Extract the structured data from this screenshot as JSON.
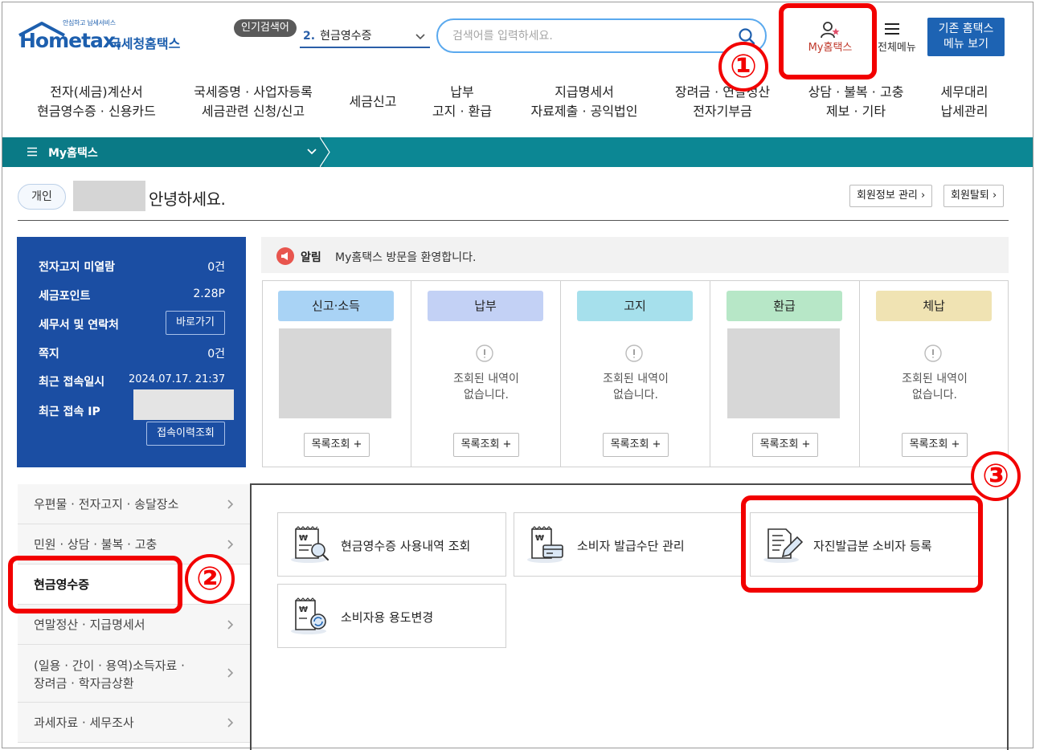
{
  "header": {
    "logo_small": "안심하고 납세서비스",
    "logo_text": "Hometax.",
    "logo_name": "국세청홈택스",
    "popular_badge": "인기검색어",
    "popular_rank": "2.",
    "popular_value": "현금영수증",
    "search_placeholder": "검색어를 입력하세요.",
    "my_hometax": "My홈택스",
    "all_menu": "전체메뉴",
    "old_menu_line1": "기존 홈택스",
    "old_menu_line2": "메뉴 보기"
  },
  "gnb": [
    {
      "line1": "전자(세금)계산서",
      "line2": "현금영수증 · 신용카드"
    },
    {
      "line1": "국세증명 · 사업자등록",
      "line2": "세금관련 신청/신고"
    },
    {
      "line1": "세금신고",
      "line2": ""
    },
    {
      "line1": "납부",
      "line2": "고지 · 환급"
    },
    {
      "line1": "지급명세서",
      "line2": "자료제출 · 공익법인"
    },
    {
      "line1": "장려금 · 연말정산",
      "line2": "전자기부금"
    },
    {
      "line1": "상담 · 불복 · 고충",
      "line2": "제보 · 기타"
    },
    {
      "line1": "세무대리",
      "line2": "납세관리"
    }
  ],
  "breadcrumb": {
    "label": "My홈택스"
  },
  "greeting": {
    "user_type": "개인",
    "text": "안녕하세요.",
    "member_info": "회원정보 관리",
    "withdraw": "회원탈퇴"
  },
  "info": {
    "rows": [
      {
        "label": "전자고지 미열람",
        "value": "0건"
      },
      {
        "label": "세금포인트",
        "value": "2.28P"
      },
      {
        "label": "세무서 및 연락처",
        "button": "바로가기"
      },
      {
        "label": "쪽지",
        "value": "0건"
      },
      {
        "label": "최근 접속일시",
        "value": "2024.07.17.  21:37"
      },
      {
        "label": "최근 접속 IP",
        "value": ""
      }
    ],
    "history_button": "접속이력조회"
  },
  "notice": {
    "label": "알림",
    "text": "My홈택스 방문을 환영합니다."
  },
  "summary": [
    {
      "tag": "신고·소득",
      "color": "#a9d3f5",
      "empty": false,
      "button": "목록조회 +"
    },
    {
      "tag": "납부",
      "color": "#c3d1f5",
      "empty": true,
      "empty_line1": "조회된 내역이",
      "empty_line2": "없습니다.",
      "button": "목록조회 +"
    },
    {
      "tag": "고지",
      "color": "#a6e0ec",
      "empty": true,
      "empty_line1": "조회된 내역이",
      "empty_line2": "없습니다.",
      "button": "목록조회 +"
    },
    {
      "tag": "환급",
      "color": "#b7e7c7",
      "empty": false,
      "button": "목록조회 +"
    },
    {
      "tag": "체납",
      "color": "#f0e3b3",
      "empty": true,
      "empty_line1": "조회된 내역이",
      "empty_line2": "없습니다.",
      "button": "목록조회 +"
    }
  ],
  "side_menu": [
    {
      "label": "우편물 · 전자고지 · 송달장소"
    },
    {
      "label": "민원 · 상담 · 불복 · 고충"
    },
    {
      "label": "현금영수증"
    },
    {
      "label": "연말정산 · 지급명세서"
    },
    {
      "label_line1": "(일용 · 간이 · 용역)소득자료 ·",
      "label_line2": "장려금 · 학자금상환"
    },
    {
      "label": "과세자료 · 세무조사"
    }
  ],
  "services": [
    {
      "label": "현금영수증 사용내역 조회",
      "icon": "receipt-search-icon"
    },
    {
      "label": "소비자 발급수단 관리",
      "icon": "receipt-card-icon"
    },
    {
      "label": "자진발급분 소비자 등록",
      "icon": "document-pen-icon"
    },
    {
      "label": "소비자용 용도변경",
      "icon": "receipt-refresh-icon"
    }
  ],
  "annotations": {
    "one": "①",
    "two": "②",
    "three": "③",
    "color": "#f20000"
  }
}
